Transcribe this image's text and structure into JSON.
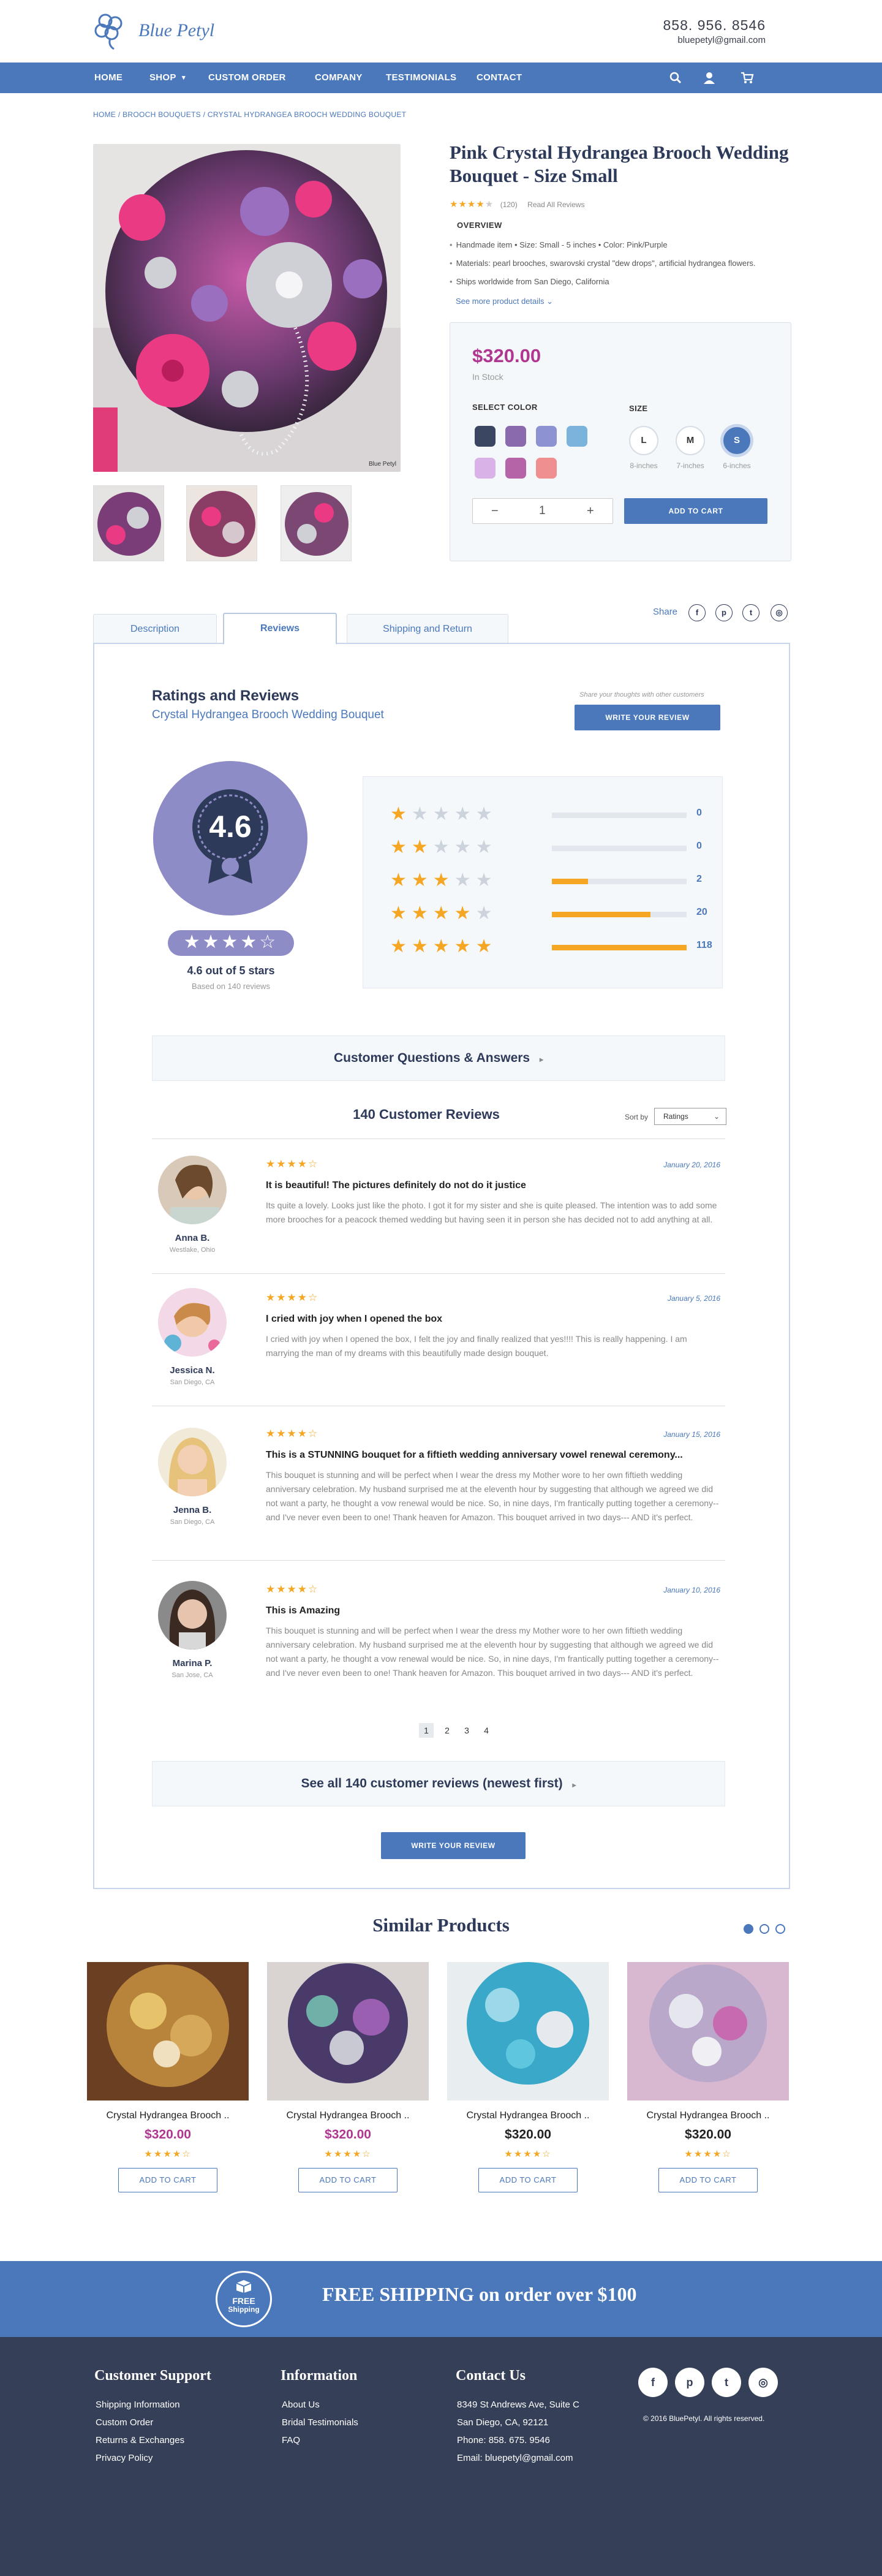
{
  "brand": {
    "name": "Blue Petyl",
    "phone": "858. 956. 8546",
    "email": "bluepetyl@gmail.com"
  },
  "nav": {
    "items": [
      "HOME",
      "SHOP",
      "CUSTOM ORDER",
      "COMPANY",
      "TESTIMONIALS",
      "CONTACT"
    ],
    "shop_caret": "▾"
  },
  "breadcrumb": "HOME / BROOCH BOUQUETS / CRYSTAL HYDRANGEA BROOCH WEDDING BOUQUET",
  "product": {
    "title": "Pink Crystal Hydrangea Brooch Wedding Bouquet - Size Small",
    "rating_count": "(120)",
    "read_reviews": "Read All Reviews",
    "overview_label": "OVERVIEW",
    "bullets": [
      "Handmade item  •  Size: Small - 5 inches  •  Color: Pink/Purple",
      "Materials: pearl brooches, swarovski crystal \"dew drops\", artificial hydrangea  flowers.",
      "Ships worldwide from San Diego, California"
    ],
    "more_details": "See more product details",
    "price": "$320.00",
    "stock": "In Stock",
    "select_color": "SELECT COLOR",
    "size_label": "SIZE",
    "colors": [
      "#3b4663",
      "#8a6aac",
      "#8d92d3",
      "#7ab3dc",
      "#d9b3e8",
      "#b565a7",
      "#ef8f90"
    ],
    "sizes": [
      {
        "label": "L",
        "cap": "8-inches"
      },
      {
        "label": "M",
        "cap": "7-inches"
      },
      {
        "label": "S",
        "cap": "6-inches"
      }
    ],
    "qty_minus": "−",
    "qty": "1",
    "qty_plus": "+",
    "add_to_cart": "ADD TO CART",
    "image_caption": "Blue Petyl"
  },
  "tabs": [
    "Description",
    "Reviews",
    "Shipping and Return"
  ],
  "share": {
    "label": "Share",
    "icons": [
      "f",
      "p",
      "t",
      "◎"
    ]
  },
  "reviews": {
    "heading": "Ratings and Reviews",
    "subheading": "Crystal Hydrangea Brooch Wedding Bouquet",
    "share_thoughts": "Share your thoughts with other customers",
    "write_btn": "WRITE YOUR REVIEW",
    "avg": "4.6",
    "avg_stars": "★★★★☆",
    "avg_text": "4.6 out of 5 stars",
    "based_on": "Based on 140 reviews",
    "distribution": [
      {
        "stars": 1,
        "count": "0",
        "fill": 0
      },
      {
        "stars": 2,
        "count": "0",
        "fill": 0
      },
      {
        "stars": 3,
        "count": "2",
        "fill": 0.27
      },
      {
        "stars": 4,
        "count": "20",
        "fill": 0.73
      },
      {
        "stars": 5,
        "count": "118",
        "fill": 1
      }
    ],
    "qa": "Customer Questions & Answers",
    "count_heading": "140 Customer Reviews",
    "sort_label": "Sort by",
    "sort_value": "Ratings",
    "items": [
      {
        "name": "Anna B.",
        "loc": "Westlake, Ohio",
        "date": "January 20, 2016",
        "stars": "★★★★☆",
        "title": "It is beautiful! The pictures definitely do not do it justice",
        "body": "Its quite a lovely. Looks just like the photo. I got it for my sister and she is quite pleased. The intention was to add some more brooches for a peacock themed wedding but having seen it in person she has decided not to add anything at all."
      },
      {
        "name": "Jessica N.",
        "loc": "San Diego, CA",
        "date": "January 5, 2016",
        "stars": "★★★★☆",
        "title": "I cried with joy when I opened the box",
        "body": "I cried with joy when I opened the box, I felt the joy and finally realized that yes!!!! This is really happening. I am marrying the man of my dreams with this beautifully made design bouquet."
      },
      {
        "name": "Jenna B.",
        "loc": "San Diego, CA",
        "date": "January 15, 2016",
        "stars": "★★★★☆",
        "title": "This is a STUNNING bouquet for a fiftieth wedding anniversary vowel renewal ceremony...",
        "body": "This bouquet is stunning and will be perfect when I wear the dress my Mother wore to her own fiftieth wedding anniversary celebration. My husband surprised me at the eleventh hour by suggesting that although we agreed we did not want a party, he thought a vow renewal would be nice. So, in nine days, I'm frantically putting together a ceremony--and I've never even been to one! Thank heaven for Amazon. This bouquet arrived in two days--- AND it's perfect."
      },
      {
        "name": "Marina P.",
        "loc": "San Jose, CA",
        "date": "January 10, 2016",
        "stars": "★★★★☆",
        "title": "This is Amazing",
        "body": "This bouquet is stunning and will be perfect when I wear the dress my Mother wore to her own fiftieth wedding anniversary celebration. My husband surprised me at the eleventh hour by suggesting that although we agreed we did not want a party, he thought a vow renewal would be nice. So, in nine days, I'm frantically putting together a ceremony--and I've never even been to one! Thank heaven for Amazon. This bouquet arrived in two days--- AND it's perfect."
      }
    ],
    "pages": [
      "1",
      "2",
      "3",
      "4"
    ],
    "see_all": "See all 140 customer reviews (newest first)"
  },
  "similar": {
    "heading": "Similar Products",
    "items": [
      {
        "name": "Crystal Hydrangea Brooch ..",
        "price": "$320.00",
        "price_color": "#b0378f",
        "stars": "★★★★☆",
        "btn": "ADD TO CART"
      },
      {
        "name": "Crystal Hydrangea Brooch ..",
        "price": "$320.00",
        "price_color": "#b0378f",
        "stars": "★★★★☆",
        "btn": "ADD TO CART"
      },
      {
        "name": "Crystal Hydrangea Brooch ..",
        "price": "$320.00",
        "price_color": "#222222",
        "stars": "★★★★☆",
        "btn": "ADD TO CART"
      },
      {
        "name": "Crystal Hydrangea Brooch ..",
        "price": "$320.00",
        "price_color": "#222222",
        "stars": "★★★★☆",
        "btn": "ADD TO CART"
      }
    ]
  },
  "shipping_banner": {
    "badge_top": "FREE",
    "badge_bottom": "Shipping",
    "text": "FREE SHIPPING on order over $100"
  },
  "footer": {
    "support": {
      "title": "Customer Support",
      "links": [
        "Shipping Information",
        "Custom Order",
        "Returns & Exchanges",
        "Privacy Policy"
      ]
    },
    "info": {
      "title": "Information",
      "links": [
        "About Us",
        "Bridal Testimonials",
        "FAQ"
      ]
    },
    "contact": {
      "title": "Contact Us",
      "lines": [
        "8349 St Andrews Ave, Suite C",
        "San Diego, CA, 92121",
        "Phone: 858. 675. 9546",
        "Email: bluepetyl@gmail.com"
      ]
    },
    "social": [
      "f",
      "p",
      "t",
      "◎"
    ],
    "copyright": "© 2016 BluePetyl. All rights reserved."
  }
}
